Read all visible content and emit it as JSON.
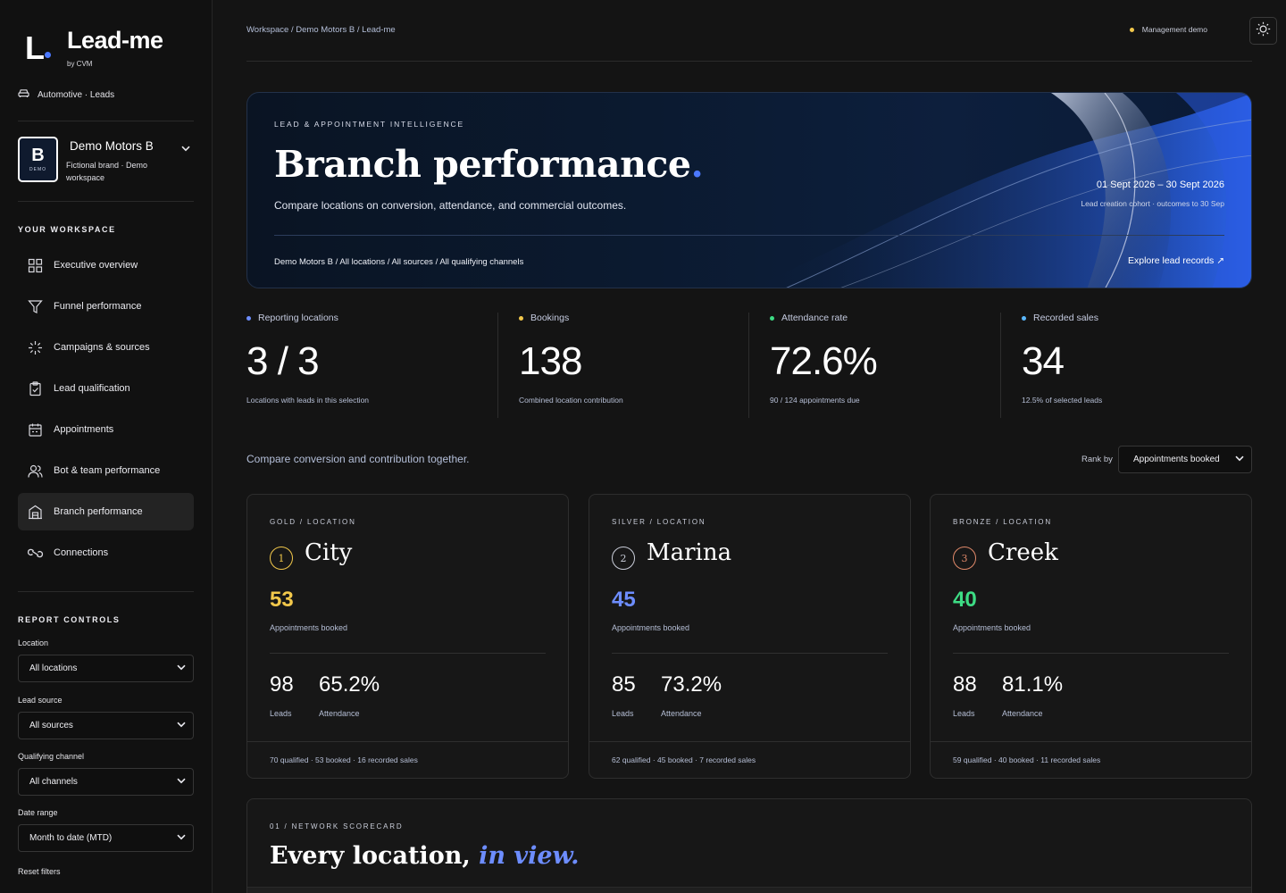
{
  "app": {
    "logo_letter": "L",
    "name": "Lead-me",
    "byline": "by CVM",
    "industry": "Automotive · Leads"
  },
  "brand": {
    "badge_letter": "B",
    "badge_tag": "DEMO",
    "name": "Demo Motors B",
    "description": "Fictional brand · Demo workspace"
  },
  "workspace": {
    "heading": "YOUR WORKSPACE",
    "items": [
      {
        "label": "Executive overview",
        "icon": "grid-icon"
      },
      {
        "label": "Funnel performance",
        "icon": "funnel-icon"
      },
      {
        "label": "Campaigns & sources",
        "icon": "sparkle-icon"
      },
      {
        "label": "Lead qualification",
        "icon": "clipboard-check-icon"
      },
      {
        "label": "Appointments",
        "icon": "calendar-icon"
      },
      {
        "label": "Bot & team performance",
        "icon": "users-icon"
      },
      {
        "label": "Branch performance",
        "icon": "building-icon",
        "active": true
      },
      {
        "label": "Connections",
        "icon": "link-icon"
      }
    ]
  },
  "controls": {
    "heading": "REPORT CONTROLS",
    "location": {
      "label": "Location",
      "value": "All locations"
    },
    "lead_source": {
      "label": "Lead source",
      "value": "All sources"
    },
    "channel": {
      "label": "Qualifying channel",
      "value": "All channels"
    },
    "date_range": {
      "label": "Date range",
      "value": "Month to date (MTD)"
    },
    "reset": "Reset filters"
  },
  "header": {
    "breadcrumb": "Workspace / Demo Motors B / Lead-me",
    "mode": "Management demo",
    "mode_color": "#f2c84b"
  },
  "hero": {
    "eyebrow": "LEAD & APPOINTMENT INTELLIGENCE",
    "title": "Branch performance",
    "title_dot": ".",
    "description": "Compare locations on conversion, attendance, and commercial outcomes.",
    "date_range": "01 Sept 2026 – 30 Sept 2026",
    "cohort": "Lead creation cohort · outcomes to 30 Sep",
    "filter_path": "Demo Motors B / All locations / All sources / All qualifying channels",
    "link": "Explore lead records ↗"
  },
  "kpis": [
    {
      "label": "Reporting locations",
      "value": "3 / 3",
      "sub": "Locations with leads in this selection",
      "color": "#6d8dff"
    },
    {
      "label": "Bookings",
      "value": "138",
      "sub": "Combined location contribution",
      "color": "#f2c84b"
    },
    {
      "label": "Attendance rate",
      "value": "72.6%",
      "sub": "90 / 124 appointments due",
      "color": "#3ddc84"
    },
    {
      "label": "Recorded sales",
      "value": "34",
      "sub": "12.5% of selected leads",
      "color": "#5ab8ff"
    }
  ],
  "compare": {
    "text": "Compare conversion and contribution together.",
    "rank_label": "Rank by",
    "rank_value": "Appointments booked"
  },
  "locations": [
    {
      "eyebrow": "GOLD / LOCATION",
      "rank": "1",
      "name": "City",
      "booked": "53",
      "booked_label": "Appointments booked",
      "leads": "98",
      "leads_label": "Leads",
      "attendance": "65.2%",
      "attendance_label": "Attendance",
      "footer": "70 qualified · 53 booked · 16 recorded sales",
      "accent": "#f2c84b"
    },
    {
      "eyebrow": "SILVER / LOCATION",
      "rank": "2",
      "name": "Marina",
      "booked": "45",
      "booked_label": "Appointments booked",
      "leads": "85",
      "leads_label": "Leads",
      "attendance": "73.2%",
      "attendance_label": "Attendance",
      "footer": "62 qualified · 45 booked · 7 recorded sales",
      "accent": "#6d8dff",
      "rank_color": "#c9cdd9"
    },
    {
      "eyebrow": "BRONZE / LOCATION",
      "rank": "3",
      "name": "Creek",
      "booked": "40",
      "booked_label": "Appointments booked",
      "leads": "88",
      "leads_label": "Leads",
      "attendance": "81.1%",
      "attendance_label": "Attendance",
      "footer": "59 qualified · 40 booked · 11 recorded sales",
      "accent": "#3ddc84",
      "rank_color": "#e0896a"
    }
  ],
  "scorecard": {
    "eyebrow": "01 / NETWORK SCORECARD",
    "title_main": "Every location,",
    "title_accent": "in view."
  }
}
